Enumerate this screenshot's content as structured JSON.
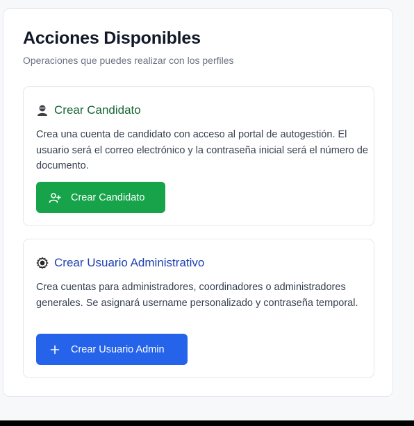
{
  "panel": {
    "title": "Acciones Disponibles",
    "subtitle": "Operaciones que puedes realizar con los perfiles"
  },
  "cards": [
    {
      "icon": "person-silhouette-icon",
      "title": "Crear Candidato",
      "description": "Crea una cuenta de candidato con acceso al portal de autogestión. El usuario será el correo electrónico y la contraseña inicial será el número de documento.",
      "button_label": "Crear Candidato",
      "button_icon": "user-plus-icon",
      "accent": "#16a34a"
    },
    {
      "icon": "gear-icon",
      "title": "Crear Usuario Administrativo",
      "description": "Crea cuentas para administradores, coordinadores o administradores generales. Se asignará username personalizado y contraseña temporal.",
      "button_label": "Crear Usuario Admin",
      "button_icon": "plus-icon",
      "accent": "#2563eb"
    }
  ]
}
